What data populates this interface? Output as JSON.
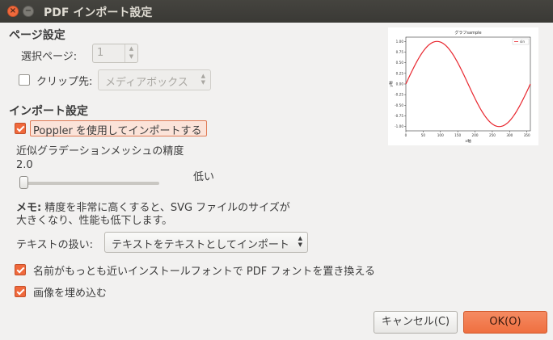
{
  "window": {
    "title": "PDF インポート設定",
    "close_glyph": "×",
    "minimize_glyph": "−"
  },
  "page_settings": {
    "heading": "ページ設定",
    "select_page_label": "選択ページ:",
    "select_page_value": "1",
    "clip_label": "クリップ先:",
    "clip_checked": false,
    "clip_value": "メディアボックス"
  },
  "import_settings": {
    "heading": "インポート設定",
    "poppler_label": "Poppler を使用してインポートする",
    "poppler_checked": true,
    "mesh_label": "近似グラデーションメッシュの精度",
    "mesh_value": "2.0",
    "slider_fraction": 0.0,
    "mesh_quality_label": "低い",
    "memo_bold": "メモ:",
    "memo_text": " 精度を非常に高くすると、SVG ファイルのサイズが",
    "memo_text2": "大きくなり、性能も低下します。",
    "text_handling_label": "テキストの扱い:",
    "text_handling_value": "テキストをテキストとしてインポート",
    "replace_fonts_label": "名前がもっとも近いインストールフォントで PDF フォントを置き換える",
    "replace_fonts_checked": true,
    "embed_images_label": "画像を埋め込む",
    "embed_images_checked": true
  },
  "buttons": {
    "cancel": "キャンセル(C)",
    "ok": "OK(O)"
  },
  "colors": {
    "accent": "#f0693c",
    "titlebar": "#3c3b37",
    "background": "#f2f1f0",
    "curve": "#e8262e"
  },
  "preview": {
    "title": "グラフsample",
    "legend": "sin",
    "xlabel": "x軸",
    "ylabel": "y軸",
    "x_ticks": [
      "0",
      "50",
      "100",
      "150",
      "200",
      "250",
      "300",
      "350"
    ],
    "y_ticks": [
      "1.00",
      "0.75",
      "0.50",
      "0.25",
      "0.00",
      "-0.25",
      "-0.50",
      "-0.75",
      "-1.00"
    ],
    "chart_data": {
      "type": "line",
      "x_range": [
        0,
        360
      ],
      "ylim": [
        -1.1,
        1.1
      ],
      "series": [
        {
          "name": "sin",
          "function": "sin(x°)",
          "x_start": 0,
          "x_end": 360
        }
      ]
    }
  }
}
